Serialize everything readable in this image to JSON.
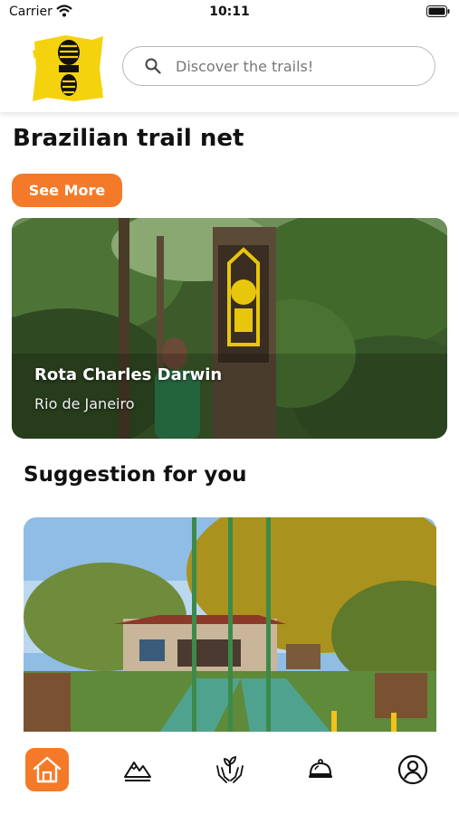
{
  "status_bar": {
    "carrier": "Carrier",
    "time": "10:11"
  },
  "header": {
    "logo_icon": "boot-print-logo",
    "search": {
      "placeholder": "Discover the trails!",
      "value": ""
    }
  },
  "featured": {
    "title": "Brazilian trail net",
    "see_more_label": "See More",
    "card": {
      "title": "Rota Charles Darwin",
      "subtitle": "Rio de Janeiro"
    }
  },
  "suggestions": {
    "title": "Suggestion for you"
  },
  "tabbar": {
    "items": [
      {
        "icon": "home-icon",
        "active": true
      },
      {
        "icon": "mountain-icon",
        "active": false
      },
      {
        "icon": "plant-hands-icon",
        "active": false
      },
      {
        "icon": "service-bell-icon",
        "active": false
      },
      {
        "icon": "profile-icon",
        "active": false
      }
    ]
  },
  "colors": {
    "accent": "#f47a29",
    "logo_yellow": "#f5d20e"
  }
}
